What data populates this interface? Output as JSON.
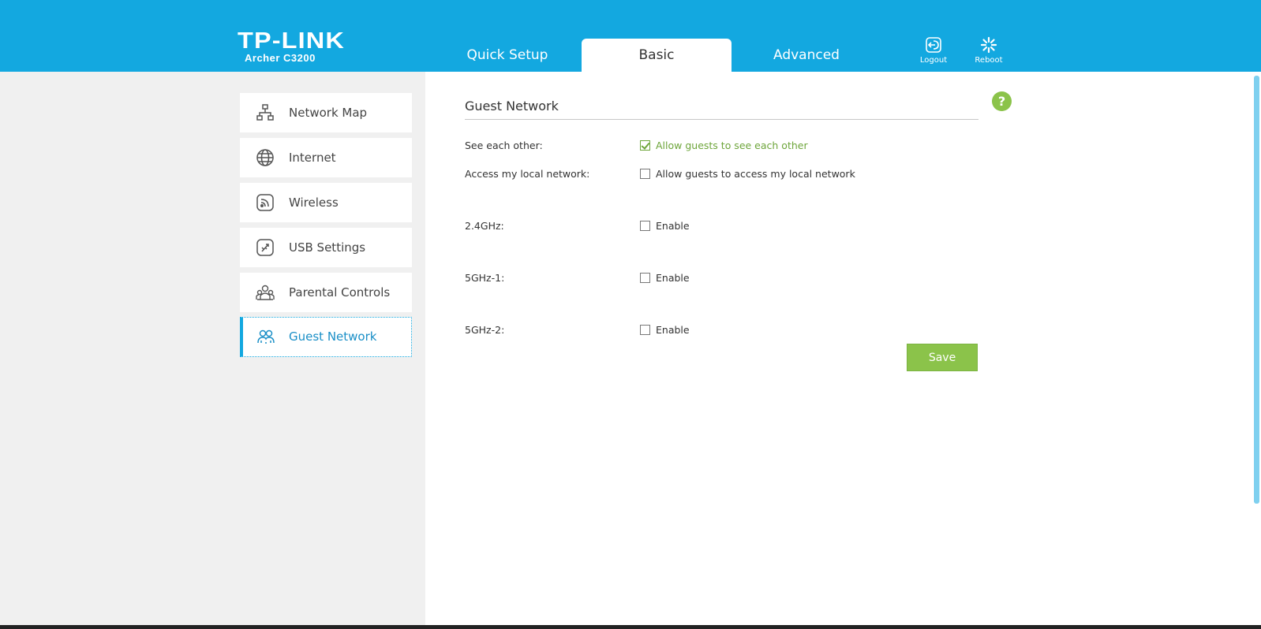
{
  "header": {
    "brand": "TP-LINK",
    "model": "Archer C3200",
    "tabs": [
      {
        "label": "Quick Setup",
        "active": false
      },
      {
        "label": "Basic",
        "active": true
      },
      {
        "label": "Advanced",
        "active": false
      }
    ],
    "logout_label": "Logout",
    "reboot_label": "Reboot"
  },
  "sidebar": {
    "items": [
      {
        "label": "Network Map",
        "icon": "network-map-icon",
        "active": false
      },
      {
        "label": "Internet",
        "icon": "globe-icon",
        "active": false
      },
      {
        "label": "Wireless",
        "icon": "wireless-icon",
        "active": false
      },
      {
        "label": "USB Settings",
        "icon": "usb-icon",
        "active": false
      },
      {
        "label": "Parental Controls",
        "icon": "parental-controls-icon",
        "active": false
      },
      {
        "label": "Guest Network",
        "icon": "guest-network-icon",
        "active": true
      }
    ]
  },
  "main": {
    "title": "Guest Network",
    "help_label": "?",
    "rows": [
      {
        "label": "See each other:",
        "option": "Allow guests to see each other",
        "checked": true
      },
      {
        "label": "Access my local network:",
        "option": "Allow guests to access my local network",
        "checked": false
      },
      {
        "label": "2.4GHz:",
        "option": "Enable",
        "checked": false
      },
      {
        "label": "5GHz-1:",
        "option": "Enable",
        "checked": false
      },
      {
        "label": "5GHz-2:",
        "option": "Enable",
        "checked": false
      }
    ],
    "save_label": "Save"
  },
  "colors": {
    "header_blue": "#13a8e0",
    "accent_green": "#8bc34a",
    "checked_green": "#6da53a",
    "active_blue": "#1a8fc7"
  }
}
